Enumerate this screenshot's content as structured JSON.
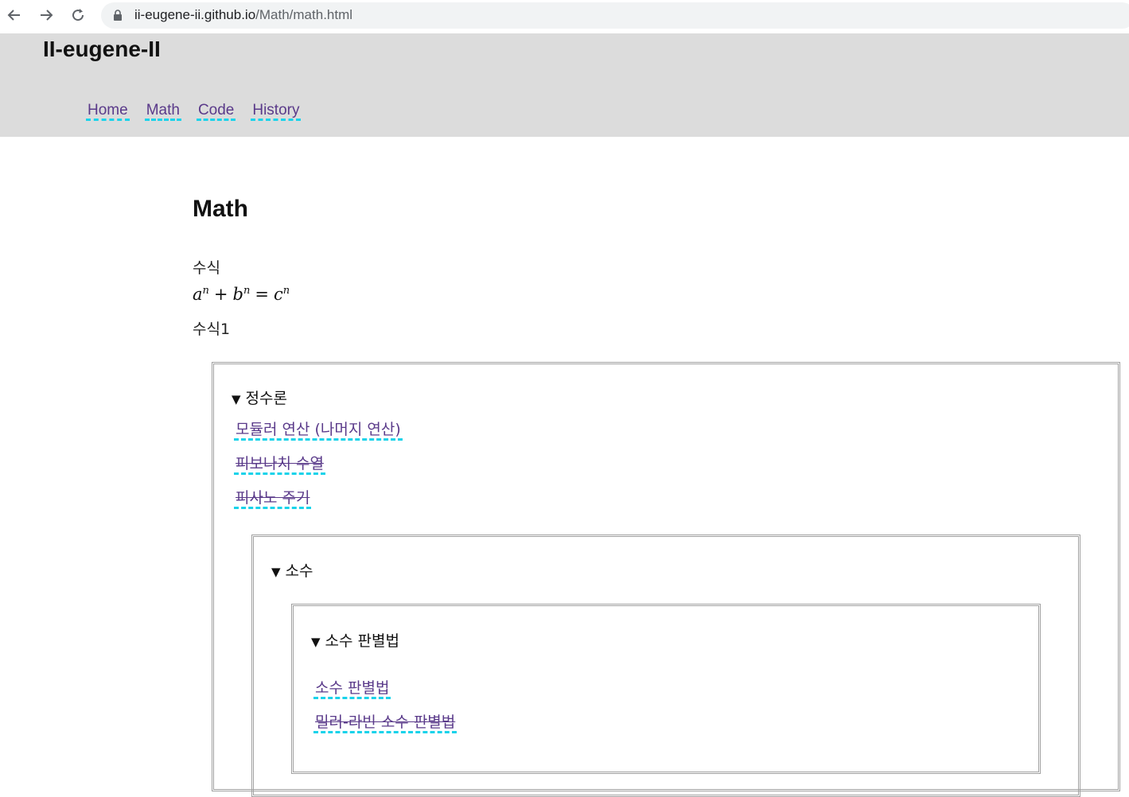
{
  "browser": {
    "url_host": "ii-eugene-ii.github.io",
    "url_path": "/Math/math.html",
    "icons": [
      "back-arrow-icon",
      "forward-arrow-icon",
      "reload-icon",
      "lock-icon"
    ]
  },
  "site": {
    "title": "II-eugene-II",
    "nav": [
      "Home",
      "Math",
      "Code",
      "History"
    ]
  },
  "main": {
    "heading": "Math",
    "formula_label": "수식",
    "formula": {
      "a": "a",
      "b": "b",
      "c": "c",
      "exp": "n",
      "plus": "+",
      "equals": "="
    },
    "formula1_label": "수식1"
  },
  "sections": {
    "number_theory": {
      "summary": "정수론",
      "links": [
        {
          "label": "모듈러 연산 (나머지 연산)",
          "struck": false
        },
        {
          "label": "피보나치 수열",
          "struck": true
        },
        {
          "label": "피사노 주기",
          "struck": true
        }
      ]
    },
    "primes": {
      "summary": "소수"
    },
    "primality": {
      "summary": "소수 판별법",
      "links": [
        {
          "label": "소수 판별법",
          "struck": false
        },
        {
          "label": "밀러-라빈 소수 판별법",
          "struck": true
        }
      ]
    }
  },
  "colors": {
    "header_bg": "#dcdcdc",
    "link": "#5a3a8a",
    "link_underline": "#19d3ea",
    "box_border": "#a0a0a0"
  }
}
